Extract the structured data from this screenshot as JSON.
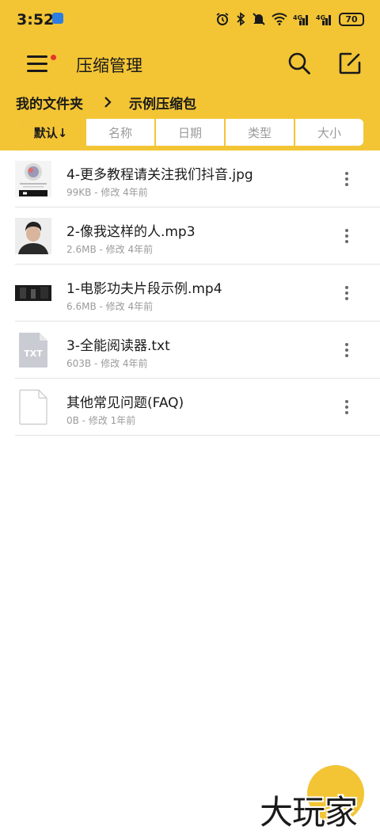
{
  "status_bar": {
    "time": "3:52",
    "battery": "70",
    "icons": [
      "alarm-icon",
      "bluetooth-icon",
      "mute-icon",
      "wifi-icon",
      "signal-icon",
      "signal-icon",
      "battery-icon"
    ]
  },
  "toolbar": {
    "title": "压缩管理",
    "menu_icon": "menu-icon",
    "search_icon": "search-icon",
    "edit_icon": "edit-icon"
  },
  "breadcrumb": {
    "root": "我的文件夹",
    "current": "示例压缩包"
  },
  "sort_tabs": [
    {
      "label": "默认↓",
      "active": true
    },
    {
      "label": "名称",
      "active": false
    },
    {
      "label": "日期",
      "active": false
    },
    {
      "label": "类型",
      "active": false
    },
    {
      "label": "大小",
      "active": false
    }
  ],
  "files": [
    {
      "name": "4-更多教程请关注我们抖音.jpg",
      "meta": "99KB - 修改 4年前",
      "thumb": "image-thumbnail"
    },
    {
      "name": "2-像我这样的人.mp3",
      "meta": "2.6MB - 修改 4年前",
      "thumb": "album-art-thumbnail"
    },
    {
      "name": "1-电影功夫片段示例.mp4",
      "meta": "6.6MB - 修改 4年前",
      "thumb": "video-thumbnail"
    },
    {
      "name": "3-全能阅读器.txt",
      "meta": "603B - 修改 4年前",
      "thumb": "txt-file-icon",
      "thumb_label": "TXT"
    },
    {
      "name": "其他常见问题(FAQ)",
      "meta": "0B - 修改 1年前",
      "thumb": "blank-file-icon"
    }
  ],
  "watermark": "大玩家",
  "colors": {
    "accent": "#f3c535",
    "notification_dot": "#e8332b",
    "text": "#1a1a1a",
    "muted": "#9b9b9b",
    "divider": "#e3e3e3"
  }
}
